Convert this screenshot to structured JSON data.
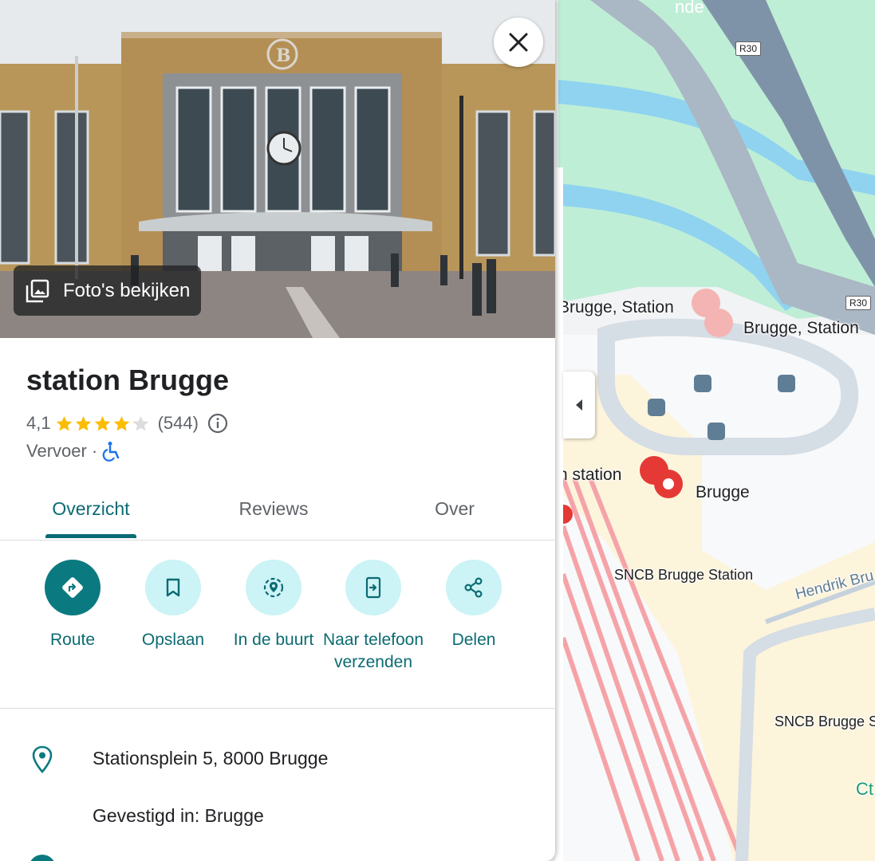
{
  "place": {
    "title": "station Brugge",
    "rating": "4,1",
    "stars": 4.1,
    "review_count": "(544)",
    "category": "Vervoer",
    "separator": "·"
  },
  "photos_button": {
    "label": "Foto's bekijken"
  },
  "tabs": [
    {
      "label": "Overzicht",
      "active": true
    },
    {
      "label": "Reviews",
      "active": false
    },
    {
      "label": "Over",
      "active": false
    }
  ],
  "actions": [
    {
      "label": "Route",
      "icon": "directions-icon"
    },
    {
      "label": "Opslaan",
      "icon": "bookmark-icon"
    },
    {
      "label": "In de buurt",
      "icon": "nearby-icon"
    },
    {
      "label": "Naar telefoon verzenden",
      "icon": "send-to-phone-icon"
    },
    {
      "label": "Delen",
      "icon": "share-icon"
    }
  ],
  "info": {
    "address": "Stationsplein 5, 8000 Brugge",
    "located_in": "Gevestigd in: Brugge"
  },
  "map": {
    "labels": {
      "station_left": "Brugge, Station",
      "station_right": "Brugge, Station",
      "n_station": "n station",
      "brugge": "Brugge",
      "sncb": "SNCB Brugge Station",
      "sncb_right": "SNCB Brugge S",
      "hendrik": "Hendrik Bru",
      "ct": "Ct",
      "top": "nde"
    },
    "shields": [
      "R30",
      "R30"
    ]
  },
  "colors": {
    "accent": "#0b6b73",
    "accent_fill": "#0b7a80",
    "action_bg": "#ccf3f5",
    "star": "#fbbc04",
    "park": "#bcecd3",
    "water": "#8fd3f0",
    "rail": "#f5a3a8"
  }
}
